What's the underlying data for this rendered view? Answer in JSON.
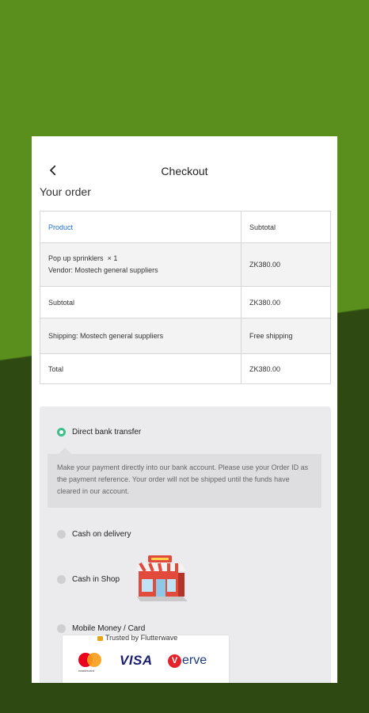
{
  "header": {
    "title": "Checkout",
    "back_icon": "chevron-left-icon"
  },
  "section_title": "Your order",
  "order_table": {
    "headers": [
      "Product",
      "Subtotal"
    ],
    "product": {
      "name": "Pop up sprinklers",
      "qty": "× 1",
      "vendor": "Vendor: Mostech general suppliers",
      "price": "ZK380.00"
    },
    "subtotal": {
      "label": "Subtotal",
      "value": "ZK380.00"
    },
    "shipping": {
      "label": "Shipping: Mostech general suppliers",
      "value": "Free shipping"
    },
    "total": {
      "label": "Total",
      "value": "ZK380.00"
    }
  },
  "payment": {
    "selected": "direct_bank_transfer",
    "options": {
      "direct_bank_transfer": "Direct bank transfer",
      "cash_on_delivery": "Cash on delivery",
      "cash_in_shop": "Cash in Shop",
      "mobile_money": "Mobile Money / Card"
    },
    "bank_description": "Make your payment directly into our bank account. Please use your Order ID as the payment reference. Your order will not be shipped until the funds have cleared in our account.",
    "flutterwave": {
      "trusted": "Trusted by Flutterwave",
      "mastercard": "mastercard",
      "visa": "VISA",
      "verve_v": "V",
      "verve_rest": "erve"
    }
  },
  "colors": {
    "bg_top": "#5a8f1d",
    "bg_bottom": "#2e4a12",
    "accent_radio": "#3dbf8a",
    "header_link": "#1e6fc6"
  }
}
